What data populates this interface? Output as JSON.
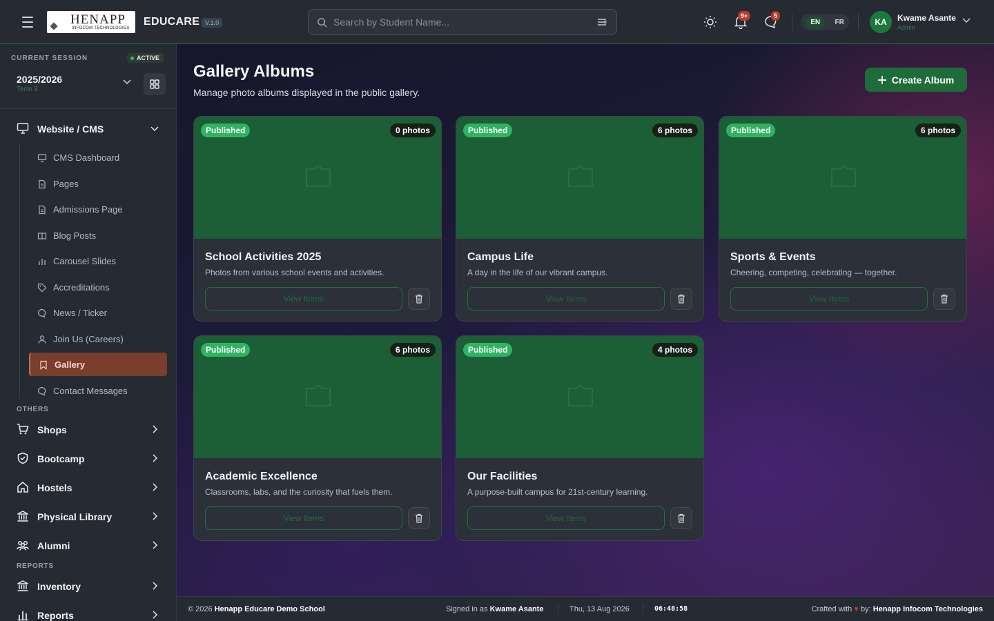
{
  "header": {
    "logo_text": "HENAPP",
    "logo_sub": "INFOCOM TECHNOLOGIES",
    "brand": "EDUCARE",
    "version": "V.1.0",
    "search_placeholder": "Search by Student Name...",
    "notifications_badge": "9+",
    "messages_badge": "5",
    "lang_en": "EN",
    "lang_fr": "FR",
    "user_initials": "KA",
    "user_name": "Kwame Asante",
    "user_role": "Admin"
  },
  "sidebar": {
    "session_label": "CURRENT SESSION",
    "session_status": "ACTIVE",
    "session_year": "2025/2026",
    "session_term": "Term 3",
    "cms_group": "Website / CMS",
    "cms_items": [
      {
        "label": "CMS Dashboard",
        "icon": "monitor-icon"
      },
      {
        "label": "Pages",
        "icon": "file-icon"
      },
      {
        "label": "Admissions Page",
        "icon": "file-icon"
      },
      {
        "label": "Blog Posts",
        "icon": "book-icon"
      },
      {
        "label": "Carousel Slides",
        "icon": "chart-icon"
      },
      {
        "label": "Accreditations",
        "icon": "tag-icon"
      },
      {
        "label": "News / Ticker",
        "icon": "chat-icon"
      },
      {
        "label": "Join Us (Careers)",
        "icon": "user-icon"
      },
      {
        "label": "Gallery",
        "icon": "bookmark-icon"
      },
      {
        "label": "Contact Messages",
        "icon": "chat-icon"
      }
    ],
    "others_label": "OTHERS",
    "others": [
      {
        "label": "Shops",
        "icon": "cart-icon"
      },
      {
        "label": "Bootcamp",
        "icon": "shield-icon"
      },
      {
        "label": "Hostels",
        "icon": "home-icon"
      },
      {
        "label": "Physical Library",
        "icon": "library-icon"
      },
      {
        "label": "Alumni",
        "icon": "users-icon"
      }
    ],
    "reports_label": "REPORTS",
    "reports": [
      {
        "label": "Inventory",
        "icon": "library-icon"
      },
      {
        "label": "Reports",
        "icon": "bar-chart-icon"
      }
    ]
  },
  "main": {
    "title": "Gallery Albums",
    "subtitle": "Manage photo albums displayed in the public gallery.",
    "create_label": "Create Album",
    "albums": [
      {
        "status": "Published",
        "photos": "0 photos",
        "title": "School Activities 2025",
        "desc": "Photos from various school events and activities.",
        "view": "View Items"
      },
      {
        "status": "Published",
        "photos": "6 photos",
        "title": "Campus Life",
        "desc": "A day in the life of our vibrant campus.",
        "view": "View Items"
      },
      {
        "status": "Published",
        "photos": "6 photos",
        "title": "Sports & Events",
        "desc": "Cheering, competing, celebrating — together.",
        "view": "View Items"
      },
      {
        "status": "Published",
        "photos": "6 photos",
        "title": "Academic Excellence",
        "desc": "Classrooms, labs, and the curiosity that fuels them.",
        "view": "View Items"
      },
      {
        "status": "Published",
        "photos": "4 photos",
        "title": "Our Facilities",
        "desc": "A purpose-built campus for 21st-century learning.",
        "view": "View Items"
      }
    ]
  },
  "footer": {
    "copyright": "© 2026",
    "school": "Henapp Educare Demo School",
    "signed_prefix": "Signed in as",
    "signed_user": "Kwame Asante",
    "date": "Thu, 13 Aug 2026",
    "time": "06:48:58",
    "crafted_prefix": "Crafted with",
    "crafted_by": "by:",
    "company": "Henapp Infocom Technologies"
  },
  "colors": {
    "accent": "#1f6b3a",
    "published": "#2fb363",
    "active_nav": "#7a3e2e"
  }
}
